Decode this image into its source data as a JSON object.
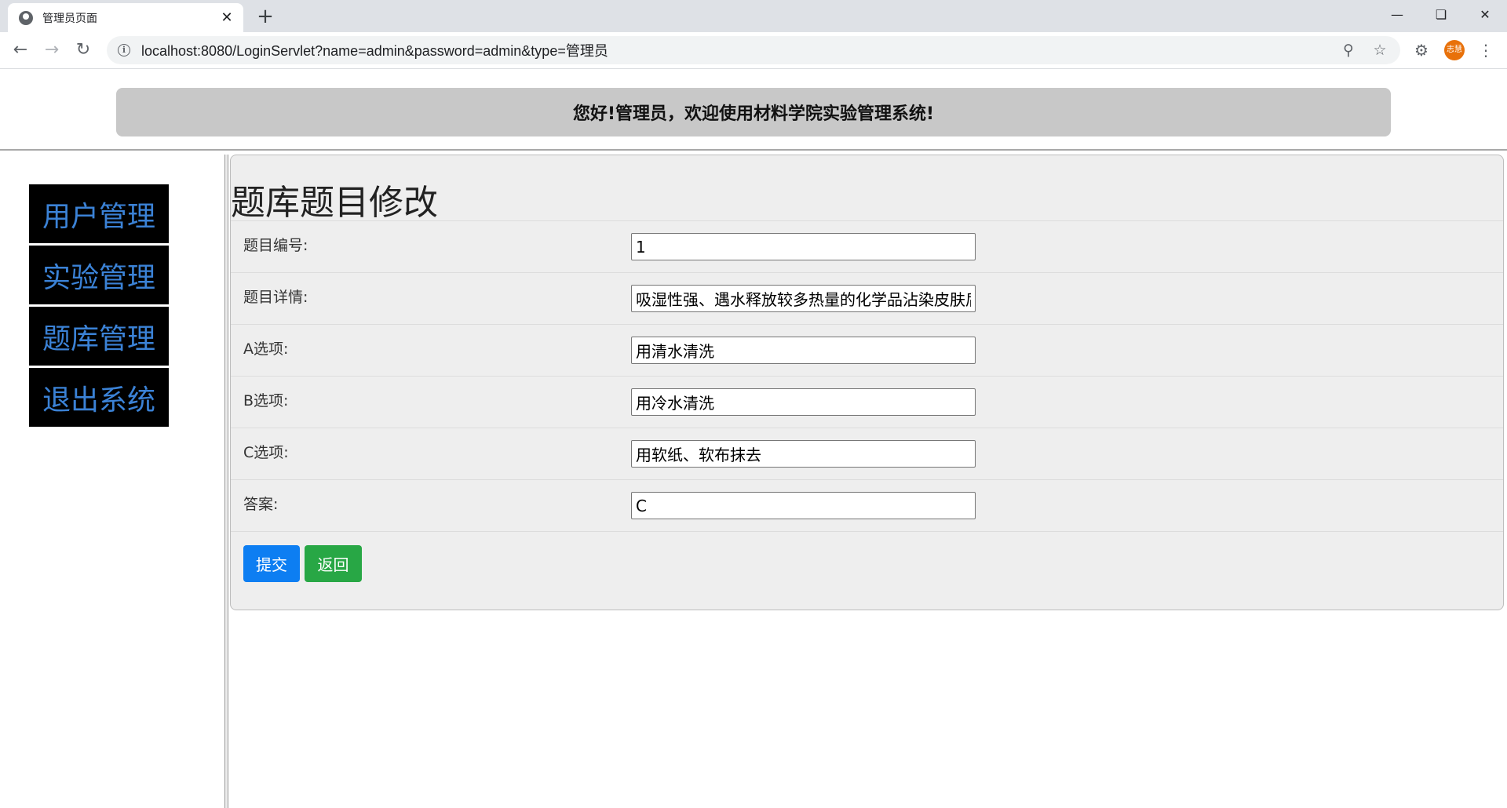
{
  "browser": {
    "tab_title": "管理员页面",
    "tab_close": "✕",
    "new_tab": "+",
    "url": "localhost:8080/LoginServlet?name=admin&password=admin&type=管理员",
    "profile_text": "志慧"
  },
  "header": {
    "welcome": "您好!管理员，欢迎使用材料学院实验管理系统!"
  },
  "sidebar": {
    "items": [
      {
        "label": "用户管理"
      },
      {
        "label": "实验管理"
      },
      {
        "label": "题库管理"
      },
      {
        "label": "退出系统"
      }
    ]
  },
  "form": {
    "title": "题库题目修改",
    "fields": [
      {
        "label": "题目编号:",
        "value": "1"
      },
      {
        "label": "题目详情:",
        "value": "吸湿性强、遇水释放较多热量的化学品沾染皮肤后"
      },
      {
        "label": "A选项:",
        "value": "用清水清洗"
      },
      {
        "label": "B选项:",
        "value": "用冷水清洗"
      },
      {
        "label": "C选项:",
        "value": "用软纸、软布抹去"
      },
      {
        "label": "答案:",
        "value": "C"
      }
    ],
    "submit_label": "提交",
    "back_label": "返回"
  },
  "colors": {
    "menu_bg": "#000000",
    "menu_text": "#3b82d6",
    "submit": "#0d7ef2",
    "back": "#28a745"
  }
}
